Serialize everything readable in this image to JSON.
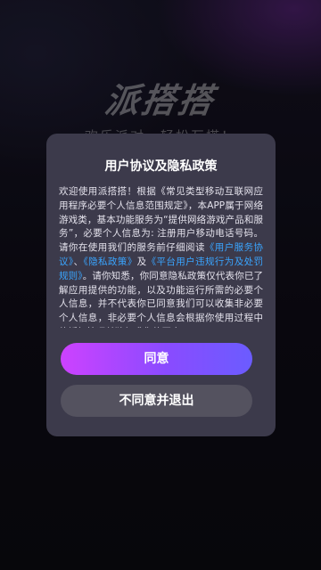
{
  "background": {
    "brand_name": "派搭搭",
    "slogan": "欢乐派对，轻松互搭！"
  },
  "dialog": {
    "title": "用户协议及隐私政策",
    "body": {
      "p1": "欢迎使用派搭搭！根据《常见类型移动互联网应用程序必要个人信息范围规定》，本APP属于网络游戏类，基本功能服务为“提供网络游戏产品和服务”，必要个人信息为: 注册用户移动电话号码。请你在使用我们的服务前仔细阅读",
      "link_user_agreement": "《用户服务协议》",
      "sep1": "、",
      "link_privacy_policy": "《隐私政策》",
      "sep2": "及",
      "link_penalty_rules": "《平台用户违规行为及处罚规则》",
      "p2": "。请你知悉，你同意隐私政策仅代表你已了解应用提供的功能，以及功能运行所需的必要个人信息，并不代表你已同意我们可以收集非必要个人信息，非必要个人信息会根据你使用过程中的授权情况单独征求你的同意。"
    },
    "agree_label": "同意",
    "disagree_label": "不同意并退出"
  },
  "colors": {
    "dialog_bg": "#3c3a4b",
    "link": "#3aa5ff",
    "agree_gradient_start": "#cd42ff",
    "agree_gradient_end": "#6b5cff",
    "disagree_bg": "#54525f"
  }
}
